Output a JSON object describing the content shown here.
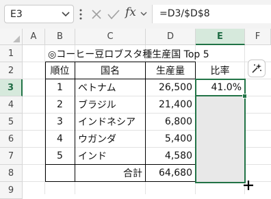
{
  "formula_bar": {
    "name_box": "E3",
    "fx_label": "fx",
    "formula": "=D3/$D$8"
  },
  "columns": [
    "A",
    "B",
    "C",
    "D",
    "E",
    "F"
  ],
  "rows": [
    "1",
    "2",
    "3",
    "4",
    "5",
    "6",
    "7",
    "8",
    "9"
  ],
  "sheet": {
    "title": "◎コーヒー豆ロブスタ種生産国 Top 5",
    "headers": {
      "rank": "順位",
      "country": "国名",
      "production": "生産量",
      "ratio": "比率"
    },
    "table": [
      {
        "rank": "1",
        "country": "ベトナム",
        "production": "26,500",
        "ratio": "41.0%"
      },
      {
        "rank": "2",
        "country": "ブラジル",
        "production": "21,400",
        "ratio": ""
      },
      {
        "rank": "3",
        "country": "インドネシア",
        "production": "6,800",
        "ratio": ""
      },
      {
        "rank": "4",
        "country": "ウガンダ",
        "production": "5,400",
        "ratio": ""
      },
      {
        "rank": "5",
        "country": "インド",
        "production": "4,580",
        "ratio": ""
      }
    ],
    "total": {
      "label": "合計",
      "value": "64,680"
    }
  },
  "colors": {
    "selection": "#217346",
    "header_selected_bg": "#d6e9dc"
  },
  "icons": [
    "chevron-down-icon",
    "more-options-icon",
    "cancel-icon",
    "enter-check-icon",
    "copilot-sparkle-icon",
    "plus-cursor-icon"
  ]
}
